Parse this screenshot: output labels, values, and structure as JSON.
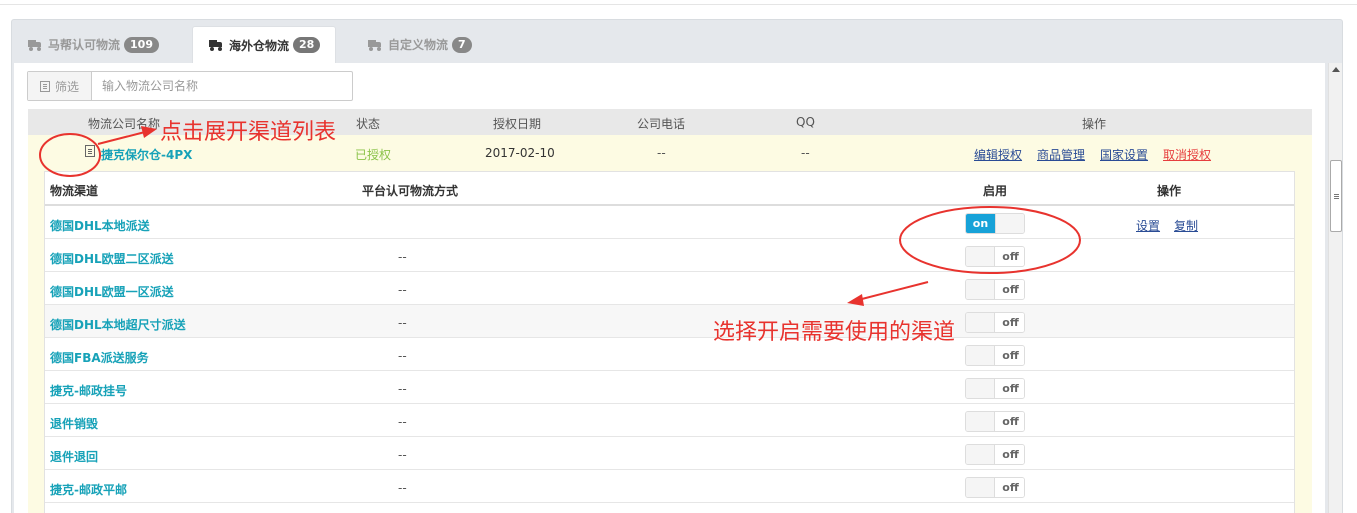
{
  "tabs": [
    {
      "label": "马帮认可物流",
      "count": "109",
      "active": false
    },
    {
      "label": "海外仓物流",
      "count": "28",
      "active": true
    },
    {
      "label": "自定义物流",
      "count": "7",
      "active": false
    }
  ],
  "filter": {
    "label": "筛选",
    "placeholder": "输入物流公司名称"
  },
  "outer_table": {
    "headers": [
      "物流公司名称",
      "状态",
      "授权日期",
      "公司电话",
      "QQ",
      "操作"
    ],
    "row": {
      "name": "捷克保尔仓-4PX",
      "status": "已授权",
      "date": "2017-02-10",
      "phone": "--",
      "qq": "--",
      "actions": [
        "编辑授权",
        "商品管理",
        "国家设置",
        "取消授权"
      ]
    }
  },
  "channel_table": {
    "headers": [
      "物流渠道",
      "平台认可物流方式",
      "启用",
      "操作"
    ],
    "rows": [
      {
        "name": "德国DHL本地派送",
        "method": "",
        "enabled": "on",
        "actions": [
          "设置",
          "复制"
        ]
      },
      {
        "name": "德国DHL欧盟二区派送",
        "method": "--",
        "enabled": "off",
        "actions": []
      },
      {
        "name": "德国DHL欧盟一区派送",
        "method": "--",
        "enabled": "off",
        "actions": []
      },
      {
        "name": "德国DHL本地超尺寸派送",
        "method": "--",
        "enabled": "off",
        "actions": []
      },
      {
        "name": "德国FBA派送服务",
        "method": "--",
        "enabled": "off",
        "actions": []
      },
      {
        "name": "捷克-邮政挂号",
        "method": "--",
        "enabled": "off",
        "actions": []
      },
      {
        "name": "退件销毁",
        "method": "--",
        "enabled": "off",
        "actions": []
      },
      {
        "name": "退件退回",
        "method": "--",
        "enabled": "off",
        "actions": []
      },
      {
        "name": "捷克-邮政平邮",
        "method": "--",
        "enabled": "off",
        "actions": []
      }
    ]
  },
  "annotations": {
    "expand_hint": "点击展开渠道列表",
    "enable_hint": "选择开启需要使用的渠道",
    "color": "#e8332e"
  },
  "colors": {
    "accent": "#17a2b8",
    "toggle_on": "#17a2d8",
    "row_highlight": "#fdfbe3",
    "cancel": "#e63e3e"
  }
}
